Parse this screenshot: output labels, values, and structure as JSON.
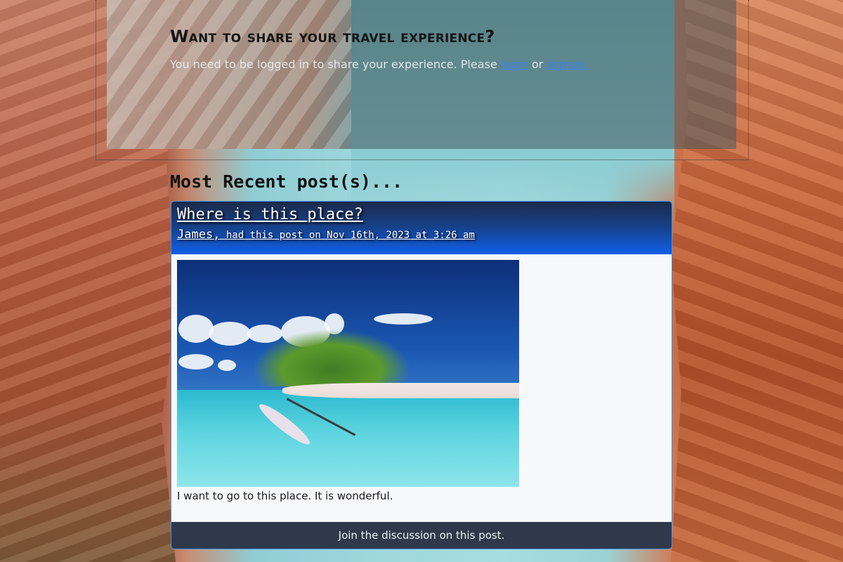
{
  "share": {
    "title": "Want to share your travel experience?",
    "text_before": "You need to be logged in to share your experience. Please ",
    "login_label": "login",
    "or_text": " or ",
    "signup_label": "signup."
  },
  "recent": {
    "heading": "Most Recent post(s)..."
  },
  "post": {
    "title": "Where is this place?",
    "author": "James,",
    "meta": " had this post on Nov 16th, 2023 at 3:26 am",
    "caption": "I want to go to this place. It is wonderful.",
    "footer_link": "Join the discussion on this post."
  },
  "colors": {
    "link": "#3b82f6",
    "header_gradient_end": "#0f5fe8",
    "footer_bg": "#2e3a4b"
  }
}
